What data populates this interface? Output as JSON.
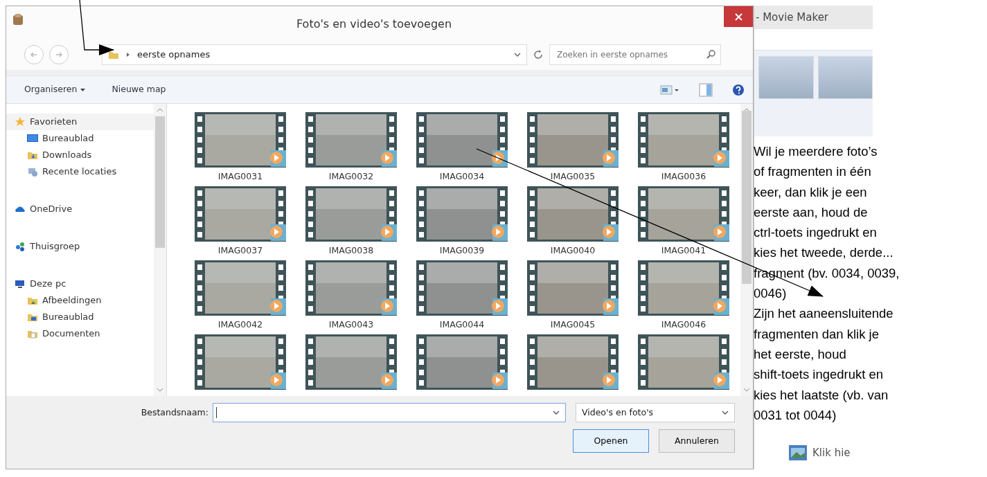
{
  "background_window": {
    "title": "- Movie Maker",
    "link": "Klik hie"
  },
  "dialog": {
    "title": "Foto's en video's toevoegen",
    "address": {
      "path": [
        "eerste opnames"
      ]
    },
    "search": {
      "placeholder": "Zoeken in eerste opnames"
    },
    "toolbar": [
      {
        "label": "Organiseren",
        "dropdown": true
      },
      {
        "label": "Nieuwe map",
        "dropdown": false
      }
    ],
    "sidebar": {
      "items": [
        {
          "label": "Favorieten",
          "kind": "star",
          "selected": true,
          "children": [
            {
              "label": "Bureaublad",
              "kind": "desktop",
              "selected": false
            },
            {
              "label": "Downloads",
              "kind": "downloads",
              "selected": false
            },
            {
              "label": "Recente locaties",
              "kind": "recent",
              "selected": false
            }
          ]
        },
        {
          "label": "OneDrive",
          "kind": "cloud",
          "selected": false
        },
        {
          "label": "Thuisgroep",
          "kind": "homegroup",
          "selected": false
        },
        {
          "label": "Deze pc",
          "kind": "pc",
          "selected": false,
          "children": [
            {
              "label": "Afbeeldingen",
              "kind": "pictures",
              "selected": false
            },
            {
              "label": "Bureaublad",
              "kind": "desktop-folder",
              "selected": false
            },
            {
              "label": "Documenten",
              "kind": "documents",
              "selected": false
            }
          ]
        }
      ]
    },
    "files": [
      {
        "kind": "video",
        "name": "IMAG0031"
      },
      {
        "kind": "video",
        "name": "IMAG0032"
      },
      {
        "kind": "video",
        "name": "IMAG0034"
      },
      {
        "kind": "video",
        "name": "IMAG0035"
      },
      {
        "kind": "video",
        "name": "IMAG0036"
      },
      {
        "kind": "video",
        "name": "IMAG0037"
      },
      {
        "kind": "video",
        "name": "IMAG0038"
      },
      {
        "kind": "video",
        "name": "IMAG0039"
      },
      {
        "kind": "video",
        "name": "IMAG0040"
      },
      {
        "kind": "video",
        "name": "IMAG0041"
      },
      {
        "kind": "video",
        "name": "IMAG0042"
      },
      {
        "kind": "video",
        "name": "IMAG0043"
      },
      {
        "kind": "video",
        "name": "IMAG0044"
      },
      {
        "kind": "video",
        "name": "IMAG0045"
      },
      {
        "kind": "video",
        "name": "IMAG0046"
      },
      {
        "kind": "video"
      },
      {
        "kind": "video"
      },
      {
        "kind": "video"
      },
      {
        "kind": "video"
      },
      {
        "kind": "video"
      }
    ],
    "filename": {
      "label": "Bestandsnaam:"
    },
    "filetype": {
      "value": "Video's en foto's"
    },
    "buttons": [
      {
        "label": "Openen",
        "default": true
      },
      {
        "label": "Annuleren",
        "default": false
      }
    ]
  },
  "annotation": {
    "paragraphs": [
      "Wil je meerdere foto’s\nof fragmenten in één\nkeer, dan klik je een\neerste aan, houd de\nctrl-toets ingedrukt en\nkies het tweede, derde...\nfragment (bv. 0034, 0039,\n0046)",
      "Zijn het aaneensluitende\nfragmenten dan klik je\nhet eerste, houd\nshift-toets ingedrukt en\nkies het laatste (vb. van\n0031 tot 0044)"
    ]
  }
}
